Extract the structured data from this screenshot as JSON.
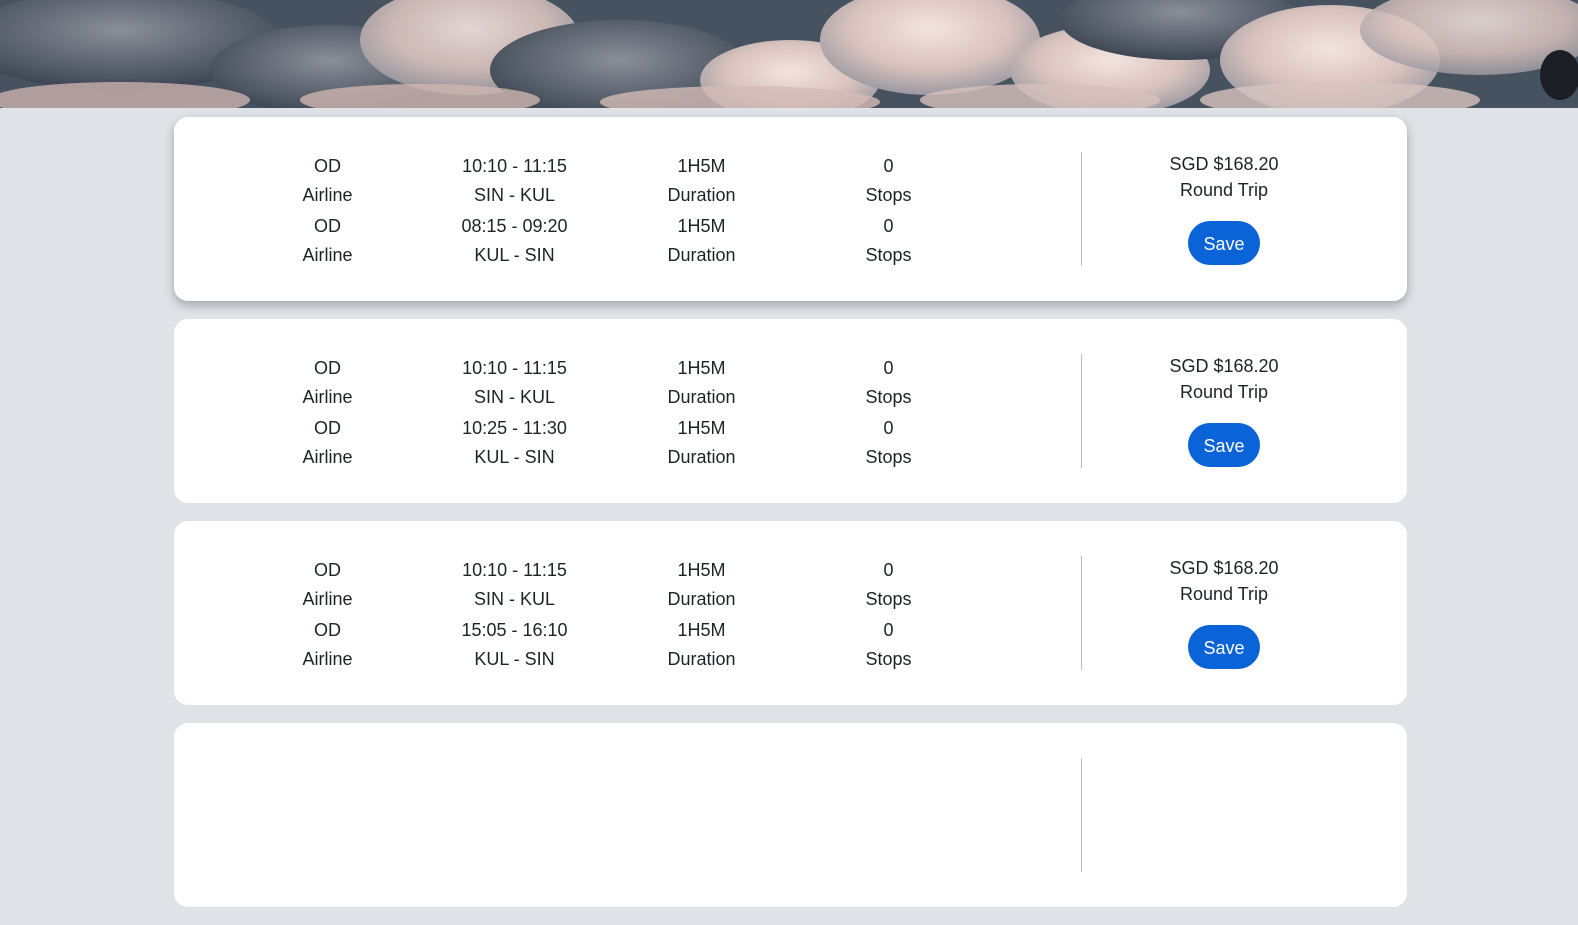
{
  "hero": {
    "icon": "clouds-banner"
  },
  "results": [
    {
      "legs": [
        {
          "airline": "OD",
          "airline_label": "Airline",
          "time": "10:10 - 11:15",
          "route": "SIN - KUL",
          "duration": "1H5M",
          "duration_label": "Duration",
          "stops": "0",
          "stops_label": "Stops"
        },
        {
          "airline": "OD",
          "airline_label": "Airline",
          "time": "08:15 - 09:20",
          "route": "KUL - SIN",
          "duration": "1H5M",
          "duration_label": "Duration",
          "stops": "0",
          "stops_label": "Stops"
        }
      ],
      "price": "SGD $168.20",
      "trip_type": "Round Trip",
      "save_label": "Save"
    },
    {
      "legs": [
        {
          "airline": "OD",
          "airline_label": "Airline",
          "time": "10:10 - 11:15",
          "route": "SIN - KUL",
          "duration": "1H5M",
          "duration_label": "Duration",
          "stops": "0",
          "stops_label": "Stops"
        },
        {
          "airline": "OD",
          "airline_label": "Airline",
          "time": "10:25 - 11:30",
          "route": "KUL - SIN",
          "duration": "1H5M",
          "duration_label": "Duration",
          "stops": "0",
          "stops_label": "Stops"
        }
      ],
      "price": "SGD $168.20",
      "trip_type": "Round Trip",
      "save_label": "Save"
    },
    {
      "legs": [
        {
          "airline": "OD",
          "airline_label": "Airline",
          "time": "10:10 - 11:15",
          "route": "SIN - KUL",
          "duration": "1H5M",
          "duration_label": "Duration",
          "stops": "0",
          "stops_label": "Stops"
        },
        {
          "airline": "OD",
          "airline_label": "Airline",
          "time": "15:05 - 16:10",
          "route": "KUL - SIN",
          "duration": "1H5M",
          "duration_label": "Duration",
          "stops": "0",
          "stops_label": "Stops"
        }
      ],
      "price": "SGD $168.20",
      "trip_type": "Round Trip",
      "save_label": "Save"
    }
  ],
  "colors": {
    "page_bg": "#dfe2e7",
    "card_bg": "#ffffff",
    "accent": "#0b63d8",
    "divider": "#b8bcc2"
  }
}
